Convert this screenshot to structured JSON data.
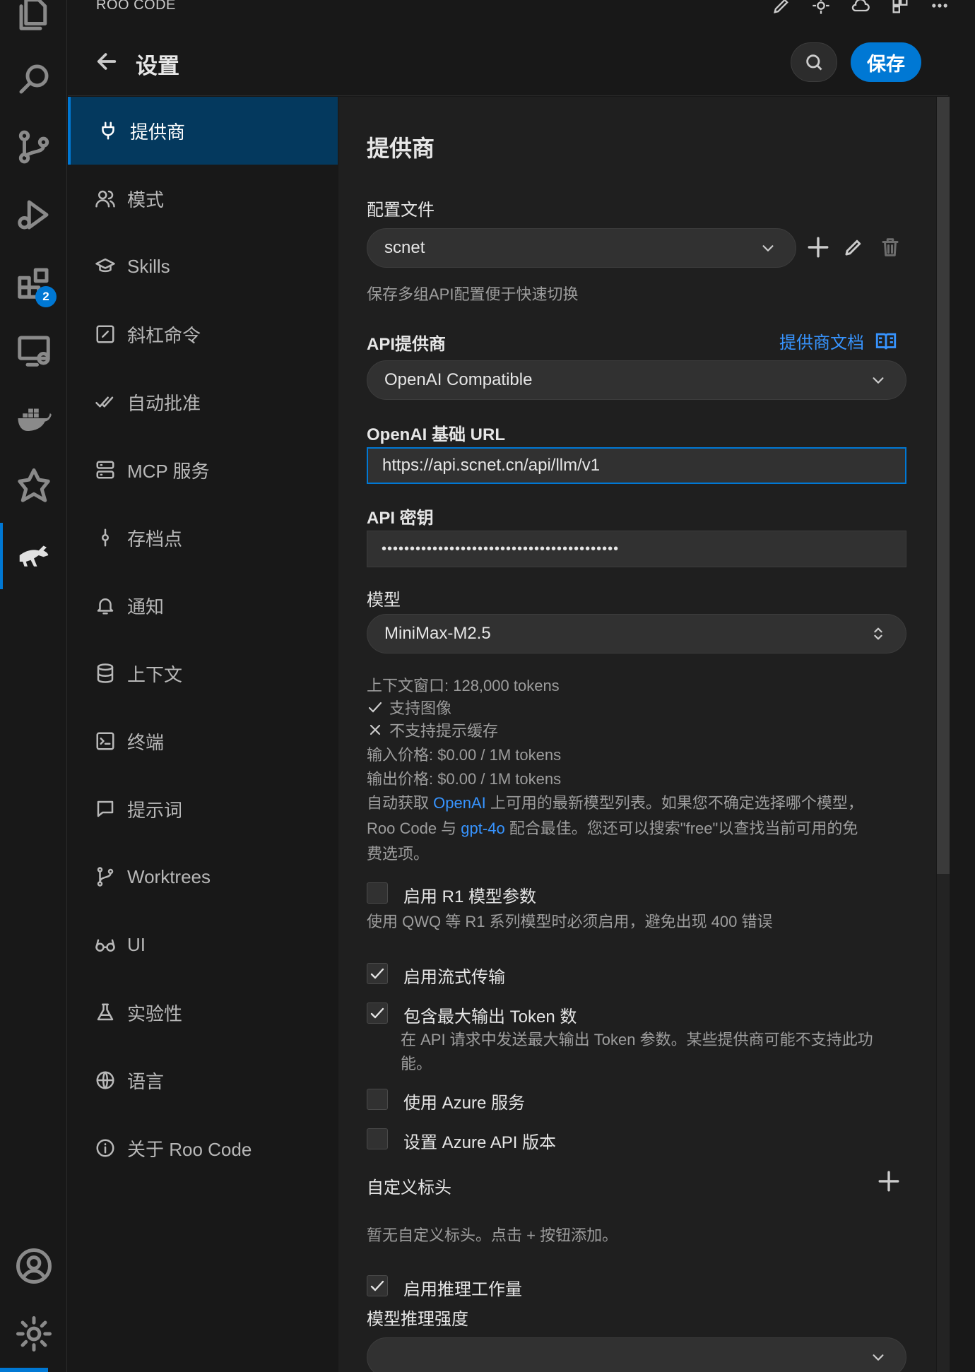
{
  "panel": {
    "label": "ROO CODE"
  },
  "activity": {
    "extensions_badge": "2"
  },
  "header": {
    "title": "设置",
    "save_label": "保存"
  },
  "nav": {
    "items": [
      {
        "label": "提供商",
        "icon": "plug-icon",
        "active": true
      },
      {
        "label": "模式",
        "icon": "users-icon"
      },
      {
        "label": "Skills",
        "icon": "graduation-cap-icon"
      },
      {
        "label": "斜杠命令",
        "icon": "slash-square-icon"
      },
      {
        "label": "自动批准",
        "icon": "check-check-icon"
      },
      {
        "label": "MCP 服务",
        "icon": "server-icon"
      },
      {
        "label": "存档点",
        "icon": "git-commit-icon"
      },
      {
        "label": "通知",
        "icon": "bell-icon"
      },
      {
        "label": "上下文",
        "icon": "database-icon"
      },
      {
        "label": "终端",
        "icon": "terminal-icon"
      },
      {
        "label": "提示词",
        "icon": "message-square-icon"
      },
      {
        "label": "Worktrees",
        "icon": "git-branch-icon"
      },
      {
        "label": "UI",
        "icon": "glasses-icon"
      },
      {
        "label": "实验性",
        "icon": "flask-icon"
      },
      {
        "label": "语言",
        "icon": "globe-icon"
      },
      {
        "label": "关于 Roo Code",
        "icon": "info-icon"
      }
    ]
  },
  "main": {
    "section_title": "提供商",
    "config": {
      "label": "配置文件",
      "value": "scnet",
      "hint": "保存多组API配置便于快速切换"
    },
    "provider": {
      "label": "API提供商",
      "docs_link": "提供商文档",
      "value": "OpenAI Compatible"
    },
    "base_url": {
      "label": "OpenAI 基础 URL",
      "value": "https://api.scnet.cn/api/llm/v1"
    },
    "api_key": {
      "label": "API 密钥",
      "value": "••••••••••••••••••••••••••••••••••••••••••"
    },
    "model": {
      "label": "模型",
      "value": "MiniMax-M2.5",
      "context_window": "上下文窗口: 128,000 tokens",
      "supports_images": "支持图像",
      "no_prompt_cache": "不支持提示缓存",
      "input_price": "输入价格: $0.00 / 1M tokens",
      "output_price": "输出价格: $0.00 / 1M tokens",
      "desc_part1": "自动获取 ",
      "desc_link1": "OpenAI",
      "desc_part2": " 上可用的最新模型列表。如果您不确定选择哪个模型，",
      "desc_part3": "Roo Code 与 ",
      "desc_link2": "gpt-4o",
      "desc_part4": " 配合最佳。您还可以搜索\"free\"以查找当前可用的免",
      "desc_part5": "费选项。"
    },
    "r1": {
      "label": "启用 R1 模型参数",
      "hint": "使用 QWQ 等 R1 系列模型时必须启用，避免出现 400 错误",
      "checked": false
    },
    "streaming": {
      "label": "启用流式传输",
      "checked": true
    },
    "max_tokens": {
      "label": "包含最大输出 Token 数",
      "hint_line1": "在 API 请求中发送最大输出 Token 参数。某些提供商可能不支持此功",
      "hint_line2": "能。",
      "checked": true
    },
    "azure": {
      "label": "使用 Azure 服务",
      "checked": false
    },
    "azure_version": {
      "label": "设置 Azure API 版本",
      "checked": false
    },
    "custom_headers": {
      "label": "自定义标头",
      "empty_hint": "暂无自定义标头。点击 + 按钮添加。"
    },
    "reasoning": {
      "label": "启用推理工作量",
      "checked": true,
      "strength_label": "模型推理强度"
    }
  },
  "colors": {
    "accent": "#0078d4",
    "link": "#3794ff",
    "active_nav": "#04395e"
  }
}
